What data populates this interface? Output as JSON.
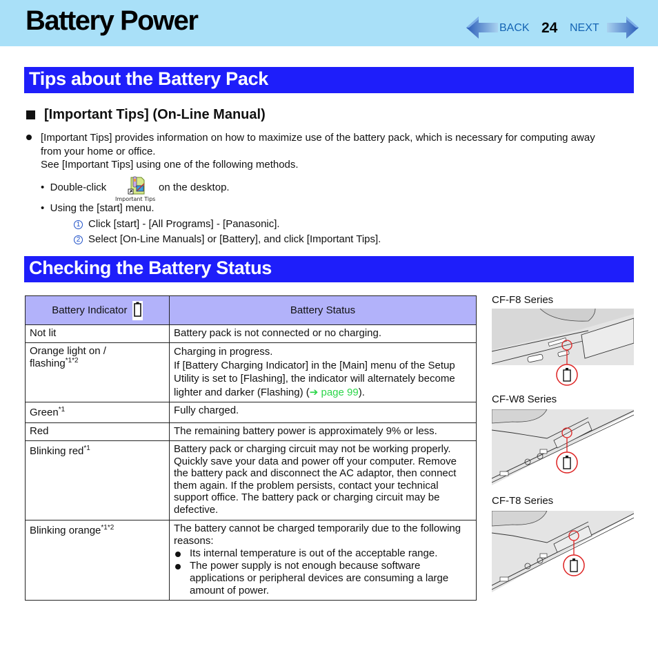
{
  "header": {
    "title": "Battery Power",
    "nav": {
      "back_label": "BACK",
      "page_number": "24",
      "next_label": "NEXT"
    }
  },
  "section_tips": {
    "title": "Tips about the Battery Pack",
    "subheading": "[Important Tips] (On-Line Manual)",
    "intro_line1": "[Important Tips] provides information on how to maximize use of the battery pack, which is necessary for computing away",
    "intro_line2": "from your home or office.",
    "intro_line3": "See [Important Tips] using one of the following methods.",
    "method1_prefix": "Double-click",
    "method1_suffix": "on the desktop.",
    "desktop_icon_label": "Important Tips",
    "method2": "Using the [start] menu.",
    "steps": [
      {
        "num": "1",
        "text": "Click [start] - [All Programs] - [Panasonic]."
      },
      {
        "num": "2",
        "text": "Select [On-Line Manuals] or [Battery], and click [Important Tips]."
      }
    ]
  },
  "section_status": {
    "title": "Checking the Battery Status",
    "table": {
      "headers": [
        "Battery Indicator",
        "Battery Status"
      ],
      "rows": [
        {
          "indicator": "Not lit",
          "note": "",
          "status": "Battery pack is not connected or no charging."
        },
        {
          "indicator_line1": "Orange light on /",
          "indicator": "flashing",
          "note": "*1*2",
          "status_line1": "Charging in progress.",
          "status_line2": "If [Battery Charging Indicator] in the [Main] menu of the Setup Utility is set to [Flashing], the indicator will alternately become lighter and darker (Flashing) (",
          "status_link": "➔ page 99",
          "status_end": ")."
        },
        {
          "indicator": "Green",
          "note": "*1",
          "status": "Fully charged."
        },
        {
          "indicator": "Red",
          "note": "",
          "status": "The remaining battery power is approximately 9% or less."
        },
        {
          "indicator": "Blinking red",
          "note": "*1",
          "status": "Battery pack or charging circuit may not be working properly. Quickly save your data and power off your computer. Remove the battery pack and disconnect the AC adaptor, then connect them again. If the problem persists, contact your technical support office. The battery pack or charging circuit may be defective."
        },
        {
          "indicator": "Blinking orange",
          "note": "*1*2",
          "status": "The battery cannot be charged temporarily due to the following reasons:",
          "bullets": [
            "Its internal temperature is out of the acceptable range.",
            "The power supply is not enough because software applications or peripheral devices are consuming a large amount of power."
          ]
        }
      ]
    },
    "illustrations": [
      {
        "label": "CF-F8 Series"
      },
      {
        "label": "CF-W8 Series"
      },
      {
        "label": "CF-T8 Series"
      }
    ],
    "colors": {
      "section_bar": "#1e1efa",
      "header_bg": "#a9e0f8",
      "table_header": "#b2b2fa",
      "link": "#2cd64a",
      "callout": "#dd2020"
    }
  }
}
